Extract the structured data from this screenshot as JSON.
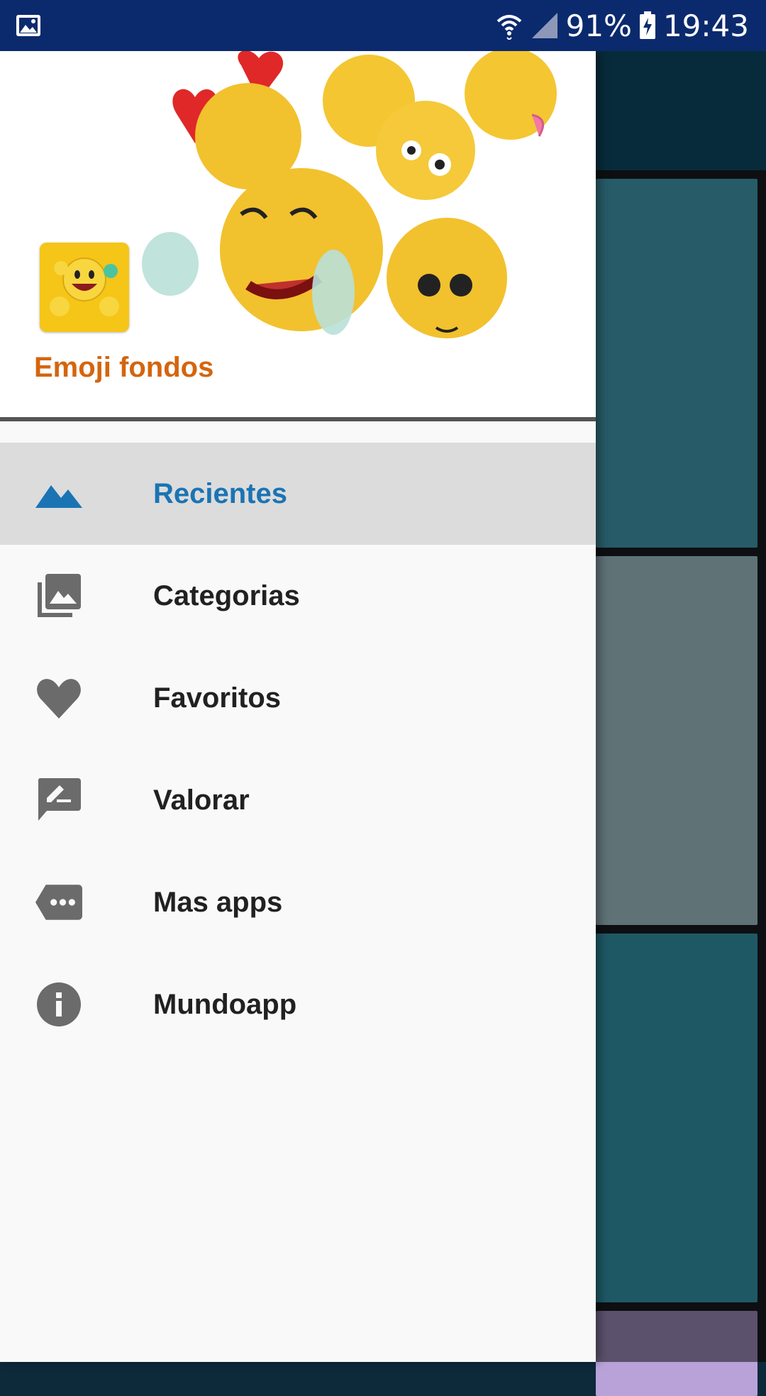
{
  "status_bar": {
    "battery": "91%",
    "time": "19:43",
    "icons": [
      "image-icon",
      "wifi-icon",
      "signal-icon",
      "battery-charging-icon"
    ]
  },
  "drawer": {
    "app_name": "Emoji fondos",
    "header_art": "emoji-faces-image",
    "menu": [
      {
        "label": "Recientes",
        "icon": "mountains-icon",
        "active": true
      },
      {
        "label": "Categorias",
        "icon": "photo-library-icon",
        "active": false
      },
      {
        "label": "Favoritos",
        "icon": "heart-icon",
        "active": false
      },
      {
        "label": "Valorar",
        "icon": "rate-review-icon",
        "active": false
      },
      {
        "label": "Mas apps",
        "icon": "more-tag-icon",
        "active": false
      },
      {
        "label": "Mundoapp",
        "icon": "info-icon",
        "active": false
      }
    ]
  },
  "colors": {
    "status_bar": "#0b2a6e",
    "app_name": "#d4650e",
    "active_label": "#1a74b4",
    "active_bg": "#dcdcdc",
    "icon_gray": "#6b6b6b",
    "active_icon": "#1a74b4"
  }
}
